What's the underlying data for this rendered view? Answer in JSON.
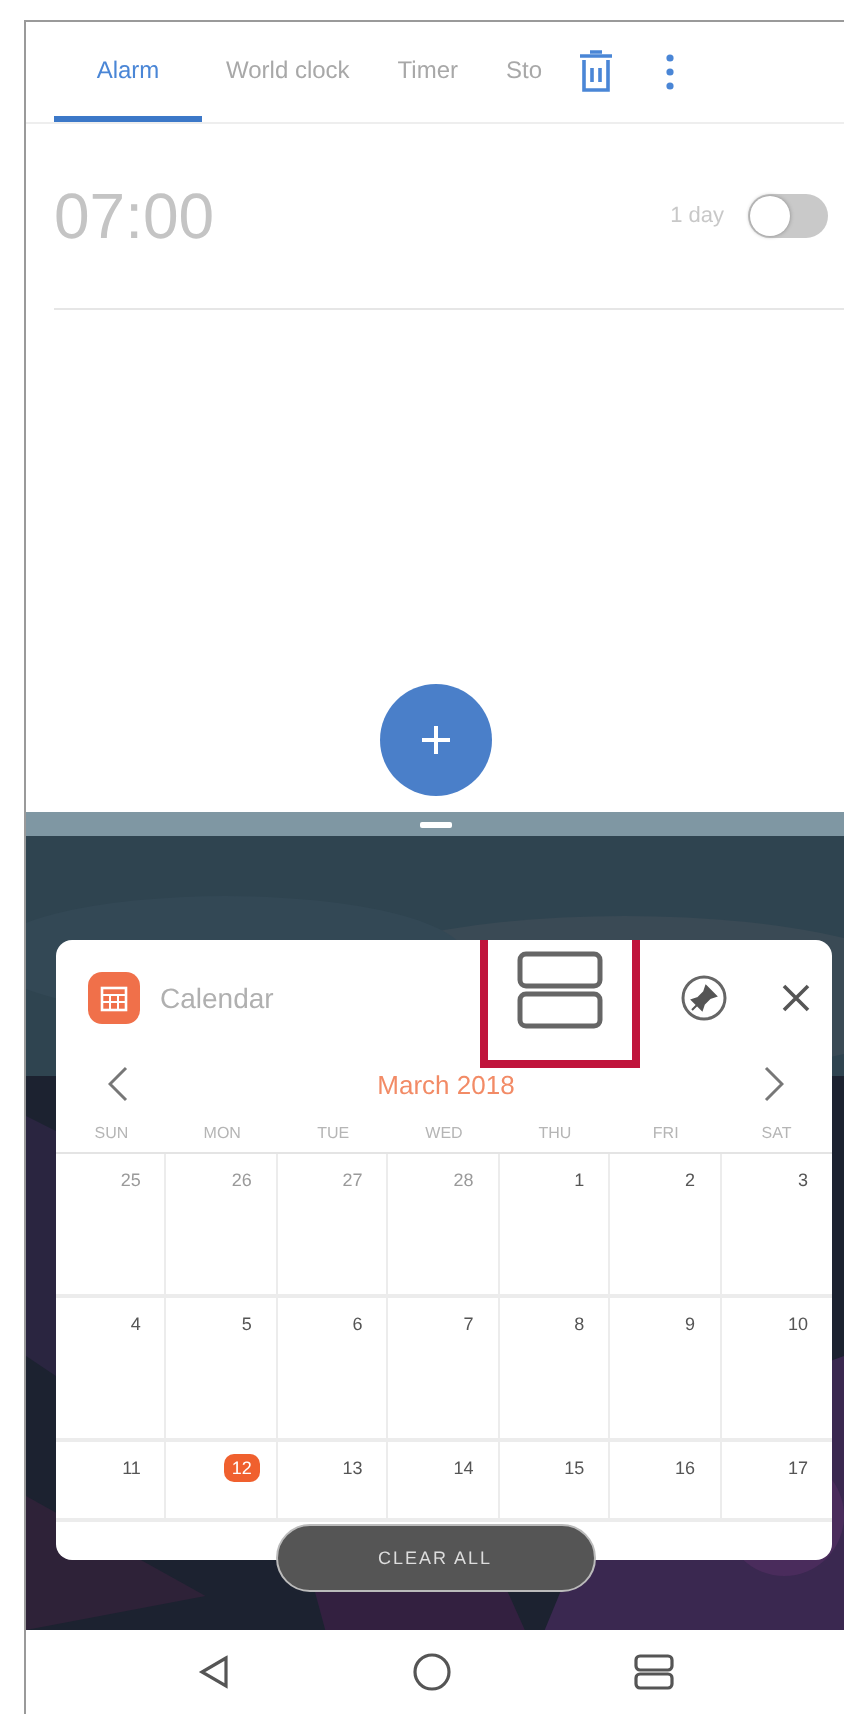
{
  "tabs": [
    {
      "label": "Alarm",
      "selected": true
    },
    {
      "label": "World clock",
      "selected": false
    },
    {
      "label": "Timer",
      "selected": false
    },
    {
      "label": "Sto",
      "selected": false
    }
  ],
  "alarms": [
    {
      "time": "07:00",
      "repeat": "1 day",
      "on": false
    }
  ],
  "popup": {
    "title": "Calendar",
    "month": "March 2018",
    "split_highlighted": true,
    "weekdays": [
      "SUN",
      "MON",
      "TUE",
      "WED",
      "THU",
      "FRI",
      "SAT"
    ],
    "weeks": [
      [
        {
          "day": "25",
          "kind": "other"
        },
        {
          "day": "26",
          "kind": "other"
        },
        {
          "day": "27",
          "kind": "other"
        },
        {
          "day": "28",
          "kind": "other"
        },
        {
          "day": "1",
          "kind": "day"
        },
        {
          "day": "2",
          "kind": "day"
        },
        {
          "day": "3",
          "kind": "day"
        }
      ],
      [
        {
          "day": "4",
          "kind": "day"
        },
        {
          "day": "5",
          "kind": "day"
        },
        {
          "day": "6",
          "kind": "day"
        },
        {
          "day": "7",
          "kind": "day"
        },
        {
          "day": "8",
          "kind": "day"
        },
        {
          "day": "9",
          "kind": "day"
        },
        {
          "day": "10",
          "kind": "day"
        }
      ],
      [
        {
          "day": "11",
          "kind": "day"
        },
        {
          "day": "12",
          "kind": "today"
        },
        {
          "day": "13",
          "kind": "day"
        },
        {
          "day": "14",
          "kind": "day"
        },
        {
          "day": "15",
          "kind": "day"
        },
        {
          "day": "16",
          "kind": "day"
        },
        {
          "day": "17",
          "kind": "day"
        }
      ]
    ]
  },
  "clear_all": "CLEAR ALL"
}
